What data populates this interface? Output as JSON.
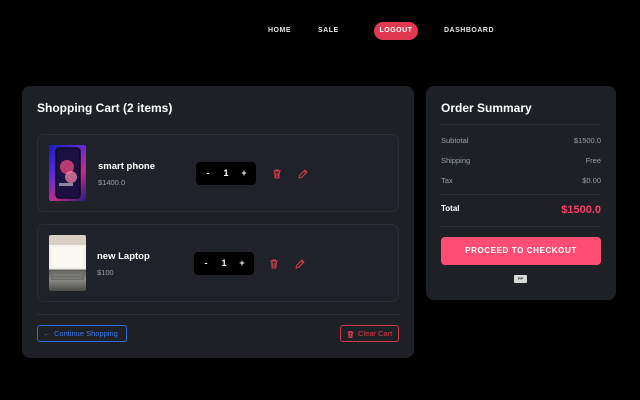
{
  "nav": {
    "home": "HOME",
    "sale": "SALE",
    "logout": "LOGOUT",
    "dashboard": "DASHBOARD"
  },
  "cart": {
    "title": "Shopping Cart (2 items)",
    "items": [
      {
        "name": "smart phone",
        "price": "$1400.0",
        "quantity": "1",
        "minus": "-",
        "plus": "+"
      },
      {
        "name": "new Laptop",
        "price": "$100",
        "quantity": "1",
        "minus": "-",
        "plus": "+"
      }
    ],
    "continue_label": "Continue Shopping",
    "continue_arrow": "←",
    "clear_label": "Clear Cart"
  },
  "summary": {
    "title": "Order Summary",
    "subtotal_label": "Subtotal",
    "subtotal_value": "$1500.0",
    "shipping_label": "Shipping",
    "shipping_value": "Free",
    "tax_label": "Tax",
    "tax_value": "$0.00",
    "total_label": "Total",
    "total_value": "$1500.0",
    "checkout_label": "PROCEED TO CHECKOUT",
    "payment_icon": "paypal-icon"
  },
  "colors": {
    "accent": "#ff4d74",
    "danger": "#e0394f",
    "link": "#3a7af0",
    "panel": "#1d2025"
  }
}
